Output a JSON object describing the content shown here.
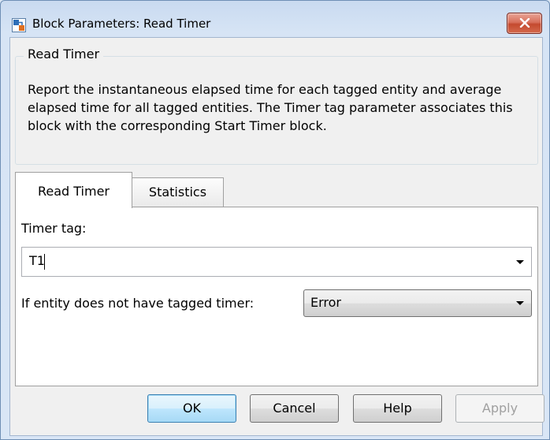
{
  "window": {
    "title": "Block Parameters: Read Timer"
  },
  "group": {
    "legend": "Read Timer",
    "description": "Report the instantaneous elapsed time for each tagged entity and average elapsed time for all tagged entities. The Timer tag parameter associates this block with the corresponding Start Timer block."
  },
  "tabs": [
    {
      "label": "Read Timer",
      "active": true
    },
    {
      "label": "Statistics",
      "active": false
    }
  ],
  "form": {
    "timer_tag_label": "Timer tag:",
    "timer_tag_value": "T1",
    "untagged_label": "If entity does not have tagged timer:",
    "untagged_value": "Error"
  },
  "buttons": {
    "ok": "OK",
    "cancel": "Cancel",
    "help": "Help",
    "apply": "Apply"
  },
  "icons": {
    "app": "simulink-block-icon",
    "close": "close-icon",
    "dropdown": "chevron-down-icon"
  },
  "colors": {
    "window_frame": "#c9daf0",
    "close_button": "#c44a2f",
    "default_button": "#bee6fd"
  }
}
